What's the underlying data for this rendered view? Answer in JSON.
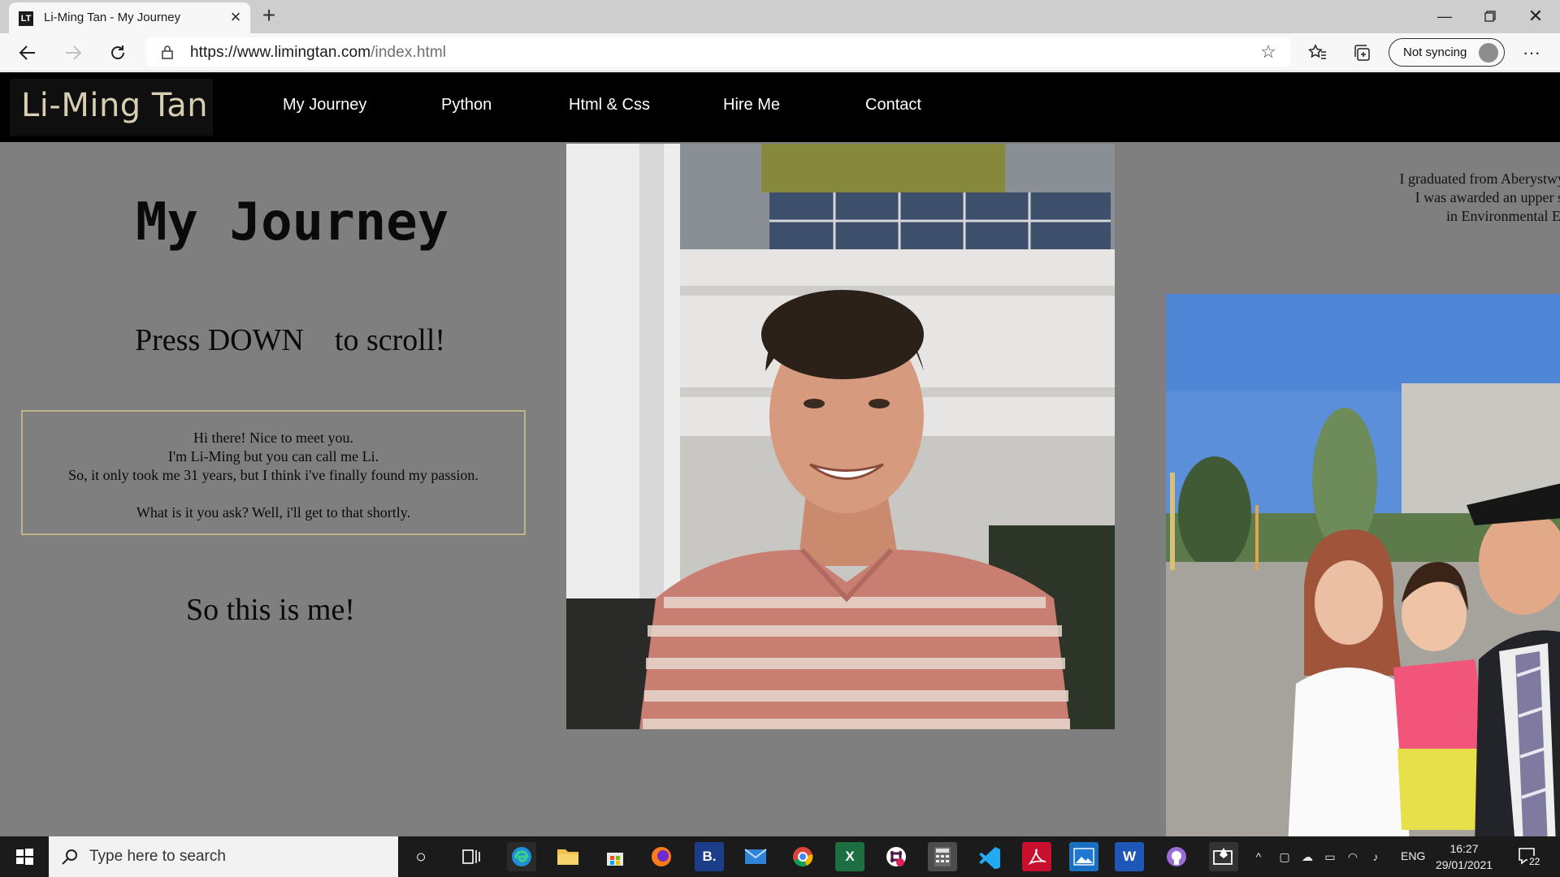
{
  "browser": {
    "tab_favicon": "LT",
    "tab_title": "Li-Ming Tan - My Journey",
    "url_host": "https://www.limingtan.com",
    "url_path": "/index.html",
    "sync_label": "Not syncing",
    "icons": [
      "back-icon",
      "forward-icon",
      "refresh-icon",
      "lock-icon",
      "add-favorite-icon",
      "favorites-icon",
      "collections-icon",
      "profile-icon",
      "more-icon",
      "minimize-icon",
      "maximize-icon",
      "close-icon"
    ]
  },
  "site": {
    "brand": "Li-Ming Tan",
    "nav": [
      "My Journey",
      "Python",
      "Html & Css",
      "Hire Me",
      "Contact"
    ],
    "heading": "My Journey",
    "press_prompt": "Press DOWN    to scroll!",
    "intro": {
      "line1": "Hi there! Nice to meet you.",
      "line2": "I'm Li-Ming but you can call me Li.",
      "line3": "So, it only took me 31 years, but I think i've finally found my passion.",
      "line4": "What is it you ask? Well, i'll get to that shortly."
    },
    "caption": "So this is me!",
    "graduation": {
      "line1": "I graduated from Aberystwyth",
      "line2": "I was awarded an upper sec",
      "line3": "in Environmental Eart"
    },
    "colors": {
      "background": "#7f7f7f",
      "navbar": "#000000",
      "brand_text": "#d7cdb0",
      "intro_border": "#bfb48a"
    }
  },
  "taskbar": {
    "search_placeholder": "Type here to search",
    "apps": [
      "cortana-icon",
      "task-view-icon",
      "edge-icon",
      "file-explorer-icon",
      "store-icon",
      "firefox-icon",
      "b-app-icon",
      "mail-icon",
      "chrome-icon",
      "excel-icon",
      "slack-icon",
      "calculator-icon",
      "vscode-icon",
      "acrobat-icon",
      "photos-icon",
      "word-icon",
      "github-icon",
      "snip-icon"
    ],
    "lang": "ENG",
    "time": "16:27",
    "date": "29/01/2021",
    "notification_count": "22"
  }
}
